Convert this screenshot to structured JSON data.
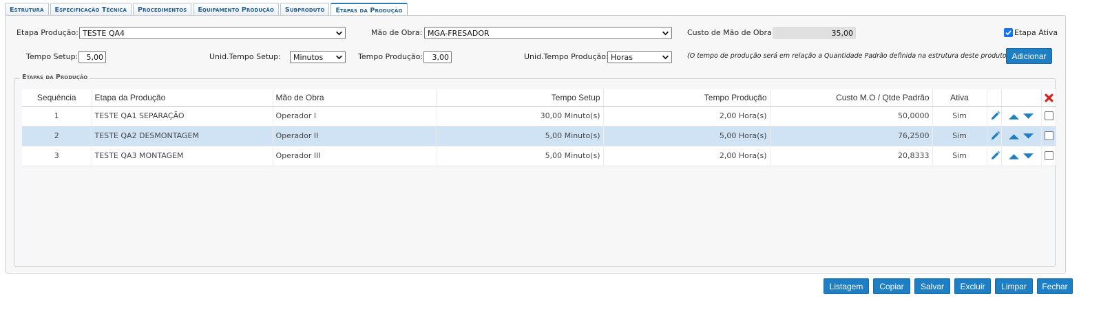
{
  "tabs": [
    {
      "label": "Estrutura",
      "active": false
    },
    {
      "label": "Especificação Técnica",
      "active": false
    },
    {
      "label": "Procedimentos",
      "active": false
    },
    {
      "label": "Equipamento Produção",
      "active": false
    },
    {
      "label": "Subproduto",
      "active": false
    },
    {
      "label": "Etapas da Produção",
      "active": true
    }
  ],
  "form": {
    "etapa_label": "Etapa Produção:",
    "etapa_value": "TESTE QA4",
    "mao_label": "Mão de Obra:",
    "mao_value": "MGA-FRESADOR",
    "custo_label": "Custo de Mão de Obra:",
    "custo_value": "35,00",
    "etapa_ativa_label": "Etapa Ativa",
    "etapa_ativa_checked": true,
    "setup_label": "Tempo Setup:",
    "setup_value": "5,00",
    "unid_setup_label": "Unid.Tempo Setup:",
    "unid_setup_value": "Minutos",
    "producao_label": "Tempo Produção:",
    "producao_value": "3,00",
    "unid_producao_label": "Unid.Tempo Produção:",
    "unid_producao_value": "Horas",
    "note": "(O tempo de produção será em relação a Quantidade Padrão definida na estrutura deste produto)",
    "add_label": "Adicionar"
  },
  "grid": {
    "legend": "Etapas da Produção",
    "columns": [
      "Sequência",
      "Etapa da Produção",
      "Mão de Obra",
      "Tempo Setup",
      "Tempo Produção",
      "Custo M.O / Qtde Padrão",
      "Ativa"
    ],
    "rows": [
      {
        "seq": "1",
        "etapa": "TESTE QA1 SEPARAÇÃO",
        "mao": "Operador I",
        "setup": "30,00 Minuto(s)",
        "producao": "2,00 Hora(s)",
        "custo": "50,0000",
        "ativa": "Sim",
        "selected": false
      },
      {
        "seq": "2",
        "etapa": "TESTE QA2 DESMONTAGEM",
        "mao": "Operador II",
        "setup": "5,00 Minuto(s)",
        "producao": "5,00 Hora(s)",
        "custo": "76,2500",
        "ativa": "Sim",
        "selected": true
      },
      {
        "seq": "3",
        "etapa": "TESTE QA3 MONTAGEM",
        "mao": "Operador III",
        "setup": "5,00 Minuto(s)",
        "producao": "2,00 Hora(s)",
        "custo": "20,8333",
        "ativa": "Sim",
        "selected": false
      }
    ]
  },
  "footer": {
    "listagem": "Listagem",
    "copiar": "Copiar",
    "salvar": "Salvar",
    "excluir": "Excluir",
    "limpar": "Limpar",
    "fechar": "Fechar"
  },
  "colors": {
    "accent": "#1f7fc4",
    "tab_text": "#1c5d92",
    "selected_row": "#cfe3f4",
    "delete_red": "#e02020"
  },
  "icons": {
    "edit": "pencil-icon",
    "up": "arrow-up-icon",
    "down": "arrow-down-icon",
    "delete_all": "red-x-icon",
    "dropdown": "chevron-down-icon"
  }
}
